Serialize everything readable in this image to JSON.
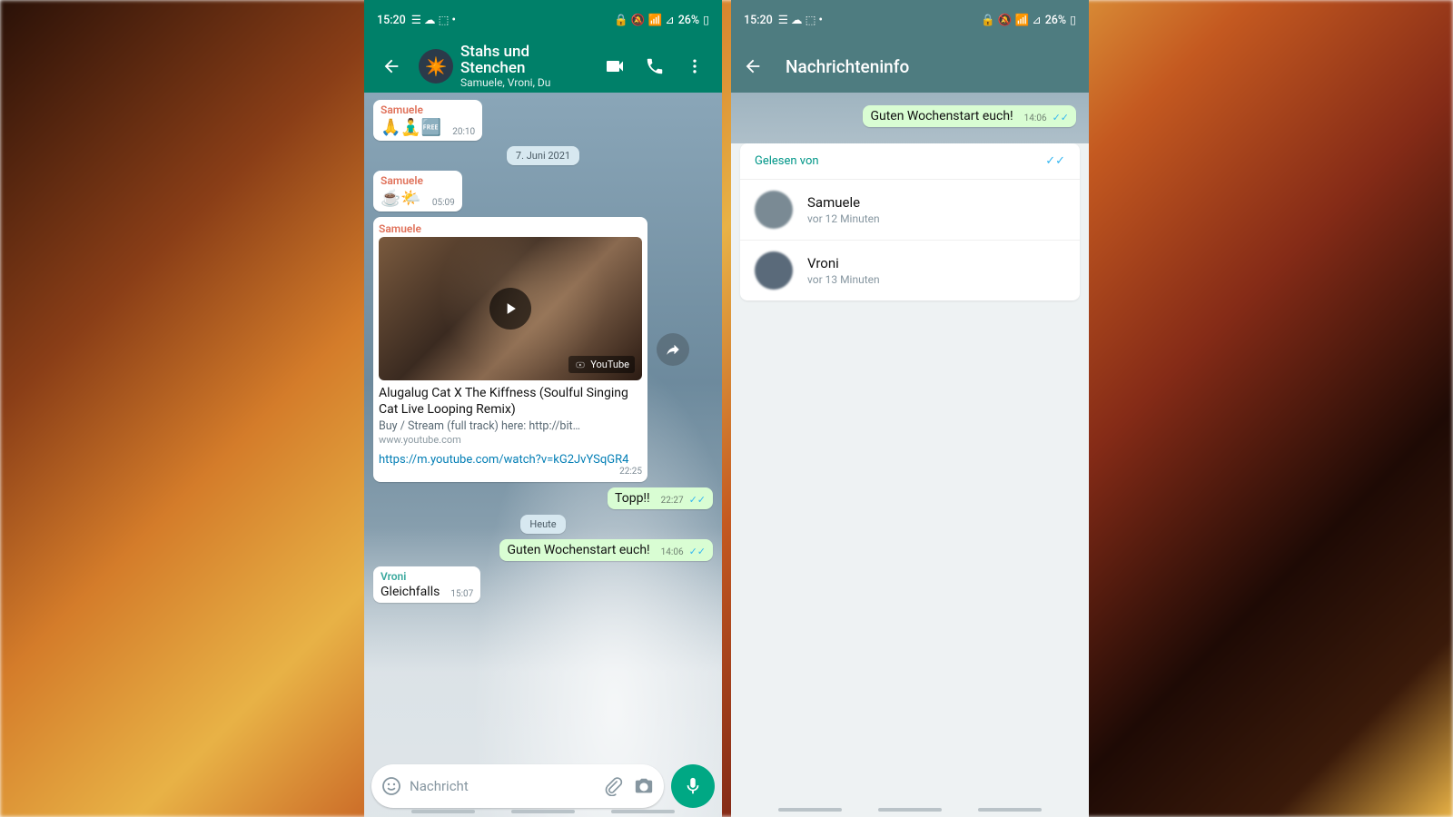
{
  "statusbar": {
    "time": "15:20",
    "battery": "26%"
  },
  "chat": {
    "title": "Stahs und Stenchen",
    "subtitle": "Samuele, Vroni, Du",
    "dates": {
      "d1": "7. Juni 2021",
      "d2": "Heute"
    },
    "msgs": {
      "m1": {
        "sender": "Samuele",
        "body": "🙏🧘‍♂️🆓",
        "time": "20:10"
      },
      "m2": {
        "sender": "Samuele",
        "body": "☕🌤️",
        "time": "05:09"
      },
      "link": {
        "sender": "Samuele",
        "title": "Alugalug Cat X The Kiffness (Soulful Singing Cat Live Looping Remix)",
        "desc": "Buy / Stream (full track) here: http://bit…",
        "host": "www.youtube.com",
        "url": "https://m.youtube.com/watch?v=kG2JvYSqGR4",
        "yt": "YouTube",
        "time": "22:25"
      },
      "m3": {
        "body": "Topp!!",
        "time": "22:27"
      },
      "m4": {
        "body": "Guten Wochenstart euch!",
        "time": "14:06"
      },
      "m5": {
        "sender": "Vroni",
        "body": "Gleichfalls",
        "time": "15:07"
      }
    },
    "composer": {
      "placeholder": "Nachricht"
    }
  },
  "info": {
    "title": "Nachrichteninfo",
    "bubble": {
      "body": "Guten Wochenstart euch!",
      "time": "14:06"
    },
    "read_header": "Gelesen von",
    "readers": [
      {
        "name": "Samuele",
        "time": "vor 12 Minuten"
      },
      {
        "name": "Vroni",
        "time": "vor 13 Minuten"
      }
    ]
  }
}
